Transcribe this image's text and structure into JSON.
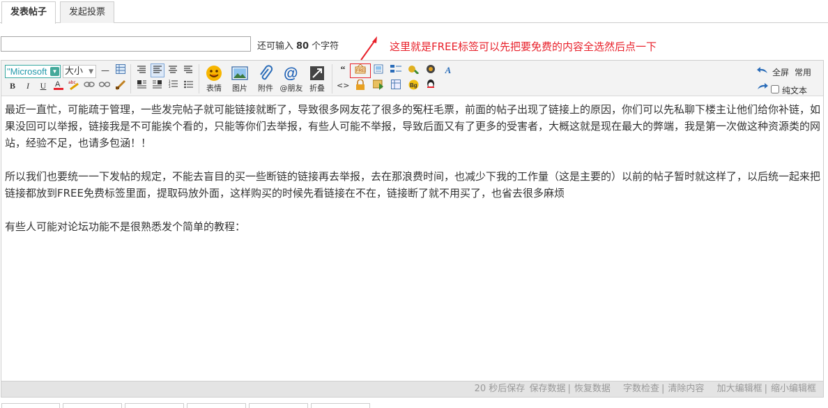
{
  "tabs": [
    {
      "label": "发表帖子",
      "active": true
    },
    {
      "label": "发起投票",
      "active": false
    }
  ],
  "title_input": {
    "value": "",
    "placeholder": ""
  },
  "counter": {
    "prefix": "还可输入",
    "count": "80",
    "suffix": "个字符"
  },
  "annotation": {
    "text": "这里就是FREE标签可以先把要免费的内容全选然后点一下",
    "color": "#e8202a"
  },
  "toolbar": {
    "font_family": "\"Microsoft",
    "font_size": "大小",
    "big_buttons": [
      {
        "label": "表情",
        "icon": "smiley-icon"
      },
      {
        "label": "图片",
        "icon": "image-icon"
      },
      {
        "label": "附件",
        "icon": "paperclip-icon"
      },
      {
        "label": "@朋友",
        "icon": "at-icon"
      },
      {
        "label": "折叠",
        "icon": "fold-icon"
      }
    ],
    "fullscreen": "全屏",
    "common": "常用",
    "plain_text": "纯文本"
  },
  "content": {
    "paragraphs": [
      "最近一直忙，可能疏于管理，一些发完帖子就可能链接就断了，导致很多网友花了很多的冤枉毛票，前面的帖子出现了链接上的原因，你们可以先私聊下楼主让他们给你补链，如果没回可以举报，链接我是不可能挨个看的，只能等你们去举报，有些人可能不举报，导致后面又有了更多的受害者，大概这就是现在最大的弊端，我是第一次做这种资源类的网站，经验不足，也请多包涵！！",
      "所以我们也要统一一下发帖的规定，不能去盲目的买一些断链的链接再去举报，去在那浪费时间，也减少下我的工作量（这是主要的）以前的帖子暂时就这样了，以后统一起来把链接都放到FREE免费标签里面，提取码放外面，这样购买的时候先看链接在不在，链接断了就不用买了，也省去很多麻烦",
      "有些人可能对论坛功能不是很熟悉发个简单的教程："
    ]
  },
  "statusbar": {
    "autosave": "20 秒后保存",
    "save": "保存数据",
    "restore": "恢复数据",
    "wordcount": "字数检查",
    "clear": "清除内容",
    "enlarge": "加大编辑框",
    "shrink": "缩小编辑框"
  }
}
